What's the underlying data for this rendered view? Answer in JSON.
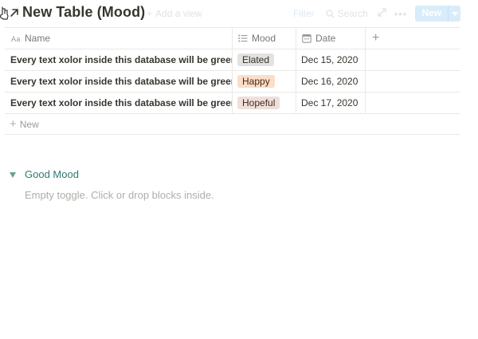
{
  "header": {
    "title": "New Table (Mood)",
    "add_view": "Add a view",
    "filter": "Filter",
    "search": "Search",
    "new_button": "New"
  },
  "table": {
    "columns": [
      {
        "label": "Name",
        "icon": "text-aa-icon"
      },
      {
        "label": "Mood",
        "icon": "list-icon"
      },
      {
        "label": "Date",
        "icon": "calendar-icon"
      }
    ],
    "rows": [
      {
        "name": "Every text xolor inside this database will be green",
        "mood": "Elated",
        "date": "Dec 15, 2020"
      },
      {
        "name": "Every text xolor inside this database will be green",
        "mood": "Happy",
        "date": "Dec 16, 2020"
      },
      {
        "name": "Every text xolor inside this database will be green",
        "mood": "Hopeful",
        "date": "Dec 17, 2020"
      }
    ],
    "new_row_label": "New"
  },
  "tag_colors": {
    "Elated": {
      "bg": "#e3e2e0",
      "fg": "#32302c"
    },
    "Happy": {
      "bg": "#fadec9",
      "fg": "#49290e"
    },
    "Hopeful": {
      "bg": "#eee0da",
      "fg": "#442a1e"
    }
  },
  "toggle": {
    "label": "Good Mood",
    "empty_hint": "Empty toggle. Click or drop blocks inside."
  }
}
